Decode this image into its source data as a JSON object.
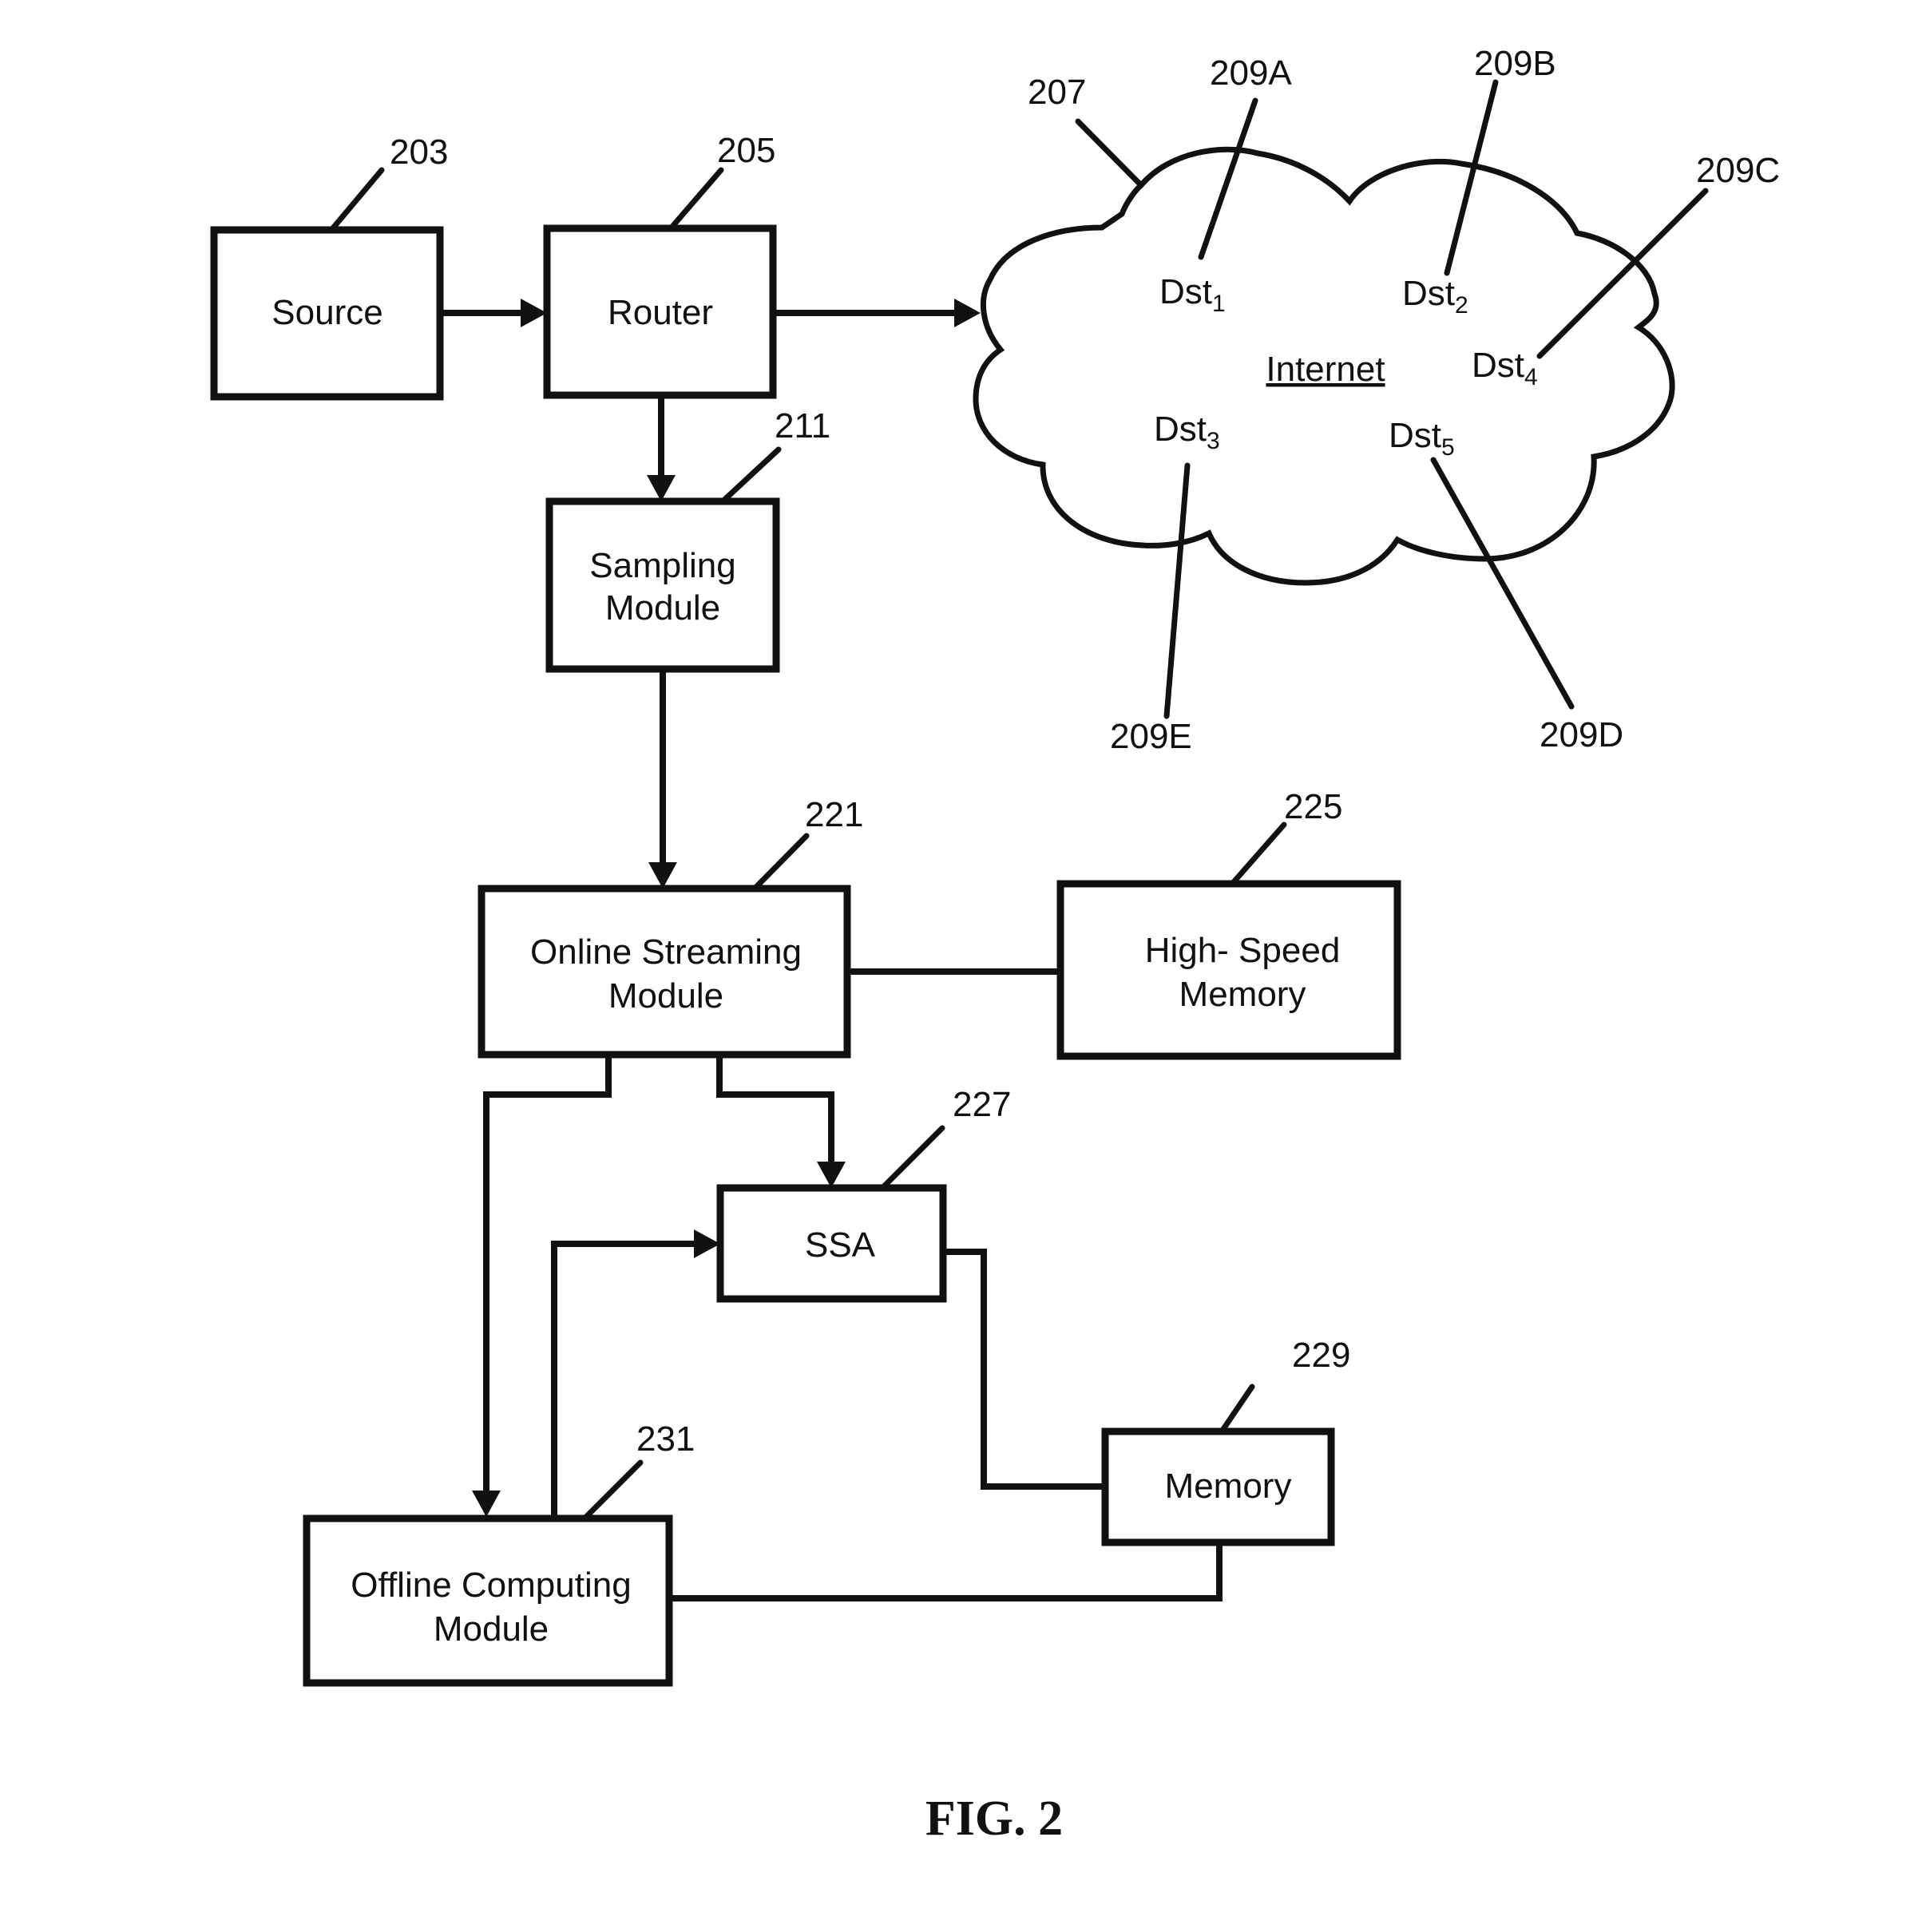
{
  "figure": {
    "caption": "FIG. 2"
  },
  "blocks": {
    "source": {
      "ref": "203",
      "lines": [
        "Source"
      ]
    },
    "router": {
      "ref": "205",
      "lines": [
        "Router"
      ]
    },
    "sampling": {
      "ref": "211",
      "lines": [
        "Sampling",
        "Module"
      ]
    },
    "online_streaming": {
      "ref": "221",
      "lines": [
        "Online Streaming",
        "Module"
      ]
    },
    "high_speed_memory": {
      "ref": "225",
      "lines": [
        "High- Speed",
        "Memory"
      ]
    },
    "ssa": {
      "ref": "227",
      "lines": [
        "SSA"
      ]
    },
    "memory": {
      "ref": "229",
      "lines": [
        "Memory"
      ]
    },
    "offline_computing": {
      "ref": "231",
      "lines": [
        "Offline Computing",
        "Module"
      ]
    }
  },
  "network": {
    "ref": "207",
    "label": "Internet",
    "destinations": [
      {
        "name": "Dst",
        "sub": "1",
        "ref": "209A"
      },
      {
        "name": "Dst",
        "sub": "2",
        "ref": "209B"
      },
      {
        "name": "Dst",
        "sub": "3",
        "ref": "209E"
      },
      {
        "name": "Dst",
        "sub": "4",
        "ref": "209C"
      },
      {
        "name": "Dst",
        "sub": "5",
        "ref": "209D"
      }
    ]
  },
  "connections": [
    {
      "from": "Source",
      "to": "Router",
      "directed": true
    },
    {
      "from": "Router",
      "to": "Internet",
      "directed": true
    },
    {
      "from": "Router",
      "to": "Sampling Module",
      "directed": true
    },
    {
      "from": "Sampling Module",
      "to": "Online Streaming Module",
      "directed": true
    },
    {
      "from": "Online Streaming Module",
      "to": "High- Speed Memory",
      "directed": false
    },
    {
      "from": "Online Streaming Module",
      "to": "SSA",
      "directed": true
    },
    {
      "from": "Online Streaming Module",
      "to": "Offline Computing Module",
      "directed": true
    },
    {
      "from": "Offline Computing Module",
      "to": "SSA",
      "directed": true
    },
    {
      "from": "SSA",
      "to": "Memory",
      "directed": false
    },
    {
      "from": "Memory",
      "to": "Offline Computing Module",
      "directed": false
    }
  ]
}
